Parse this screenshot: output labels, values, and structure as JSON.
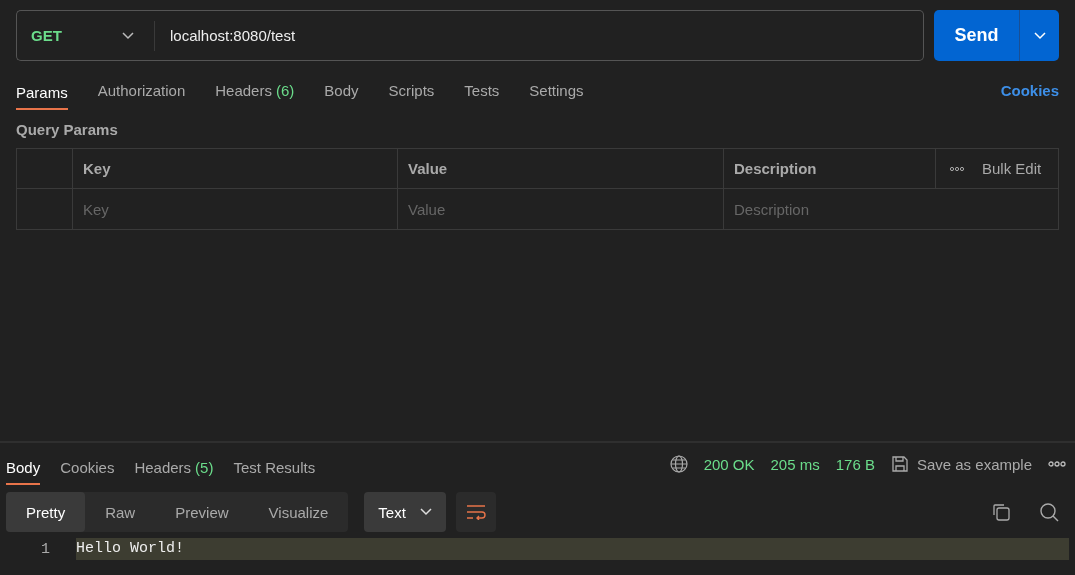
{
  "request": {
    "method": "GET",
    "url": "localhost:8080/test",
    "send_label": "Send"
  },
  "request_tabs": [
    {
      "label": "Params",
      "selected": true
    },
    {
      "label": "Authorization",
      "selected": false
    },
    {
      "label": "Headers",
      "count": "(6)",
      "selected": false
    },
    {
      "label": "Body",
      "selected": false
    },
    {
      "label": "Scripts",
      "selected": false
    },
    {
      "label": "Tests",
      "selected": false
    },
    {
      "label": "Settings",
      "selected": false
    }
  ],
  "cookies_link": "Cookies",
  "query_params": {
    "title": "Query Params",
    "columns": [
      "Key",
      "Value",
      "Description"
    ],
    "bulk_edit": "Bulk Edit",
    "placeholders": [
      "Key",
      "Value",
      "Description"
    ]
  },
  "response": {
    "tabs": [
      {
        "label": "Body",
        "selected": true
      },
      {
        "label": "Cookies",
        "selected": false
      },
      {
        "label": "Headers",
        "count": "(5)",
        "selected": false
      },
      {
        "label": "Test Results",
        "selected": false
      }
    ],
    "status": "200 OK",
    "time": "205 ms",
    "size": "176 B",
    "save_label": "Save as example",
    "view_modes": [
      {
        "label": "Pretty",
        "selected": true
      },
      {
        "label": "Raw",
        "selected": false
      },
      {
        "label": "Preview",
        "selected": false
      },
      {
        "label": "Visualize",
        "selected": false
      }
    ],
    "format": "Text",
    "lines": [
      {
        "number": "1",
        "text": "Hello World!",
        "highlighted": true
      }
    ]
  }
}
